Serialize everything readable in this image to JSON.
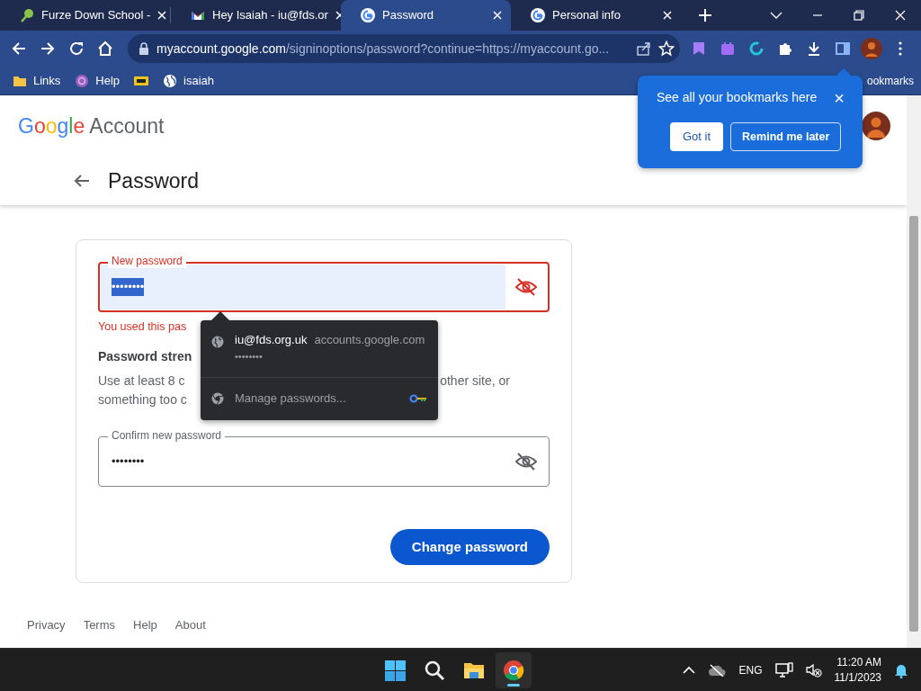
{
  "browser": {
    "tabs": [
      {
        "title": "Furze Down School - ",
        "kind": "leaf",
        "selected": false
      },
      {
        "title": "Hey Isaiah - iu@fds.or",
        "kind": "mail",
        "selected": false
      },
      {
        "title": "Password",
        "kind": "google",
        "selected": true
      },
      {
        "title": "Personal info",
        "kind": "google",
        "selected": false
      }
    ],
    "address": {
      "host": "myaccount.google.com",
      "path": "/signinoptions/password?continue=https://myaccount.go..."
    },
    "bookmarks": [
      {
        "label": "Links",
        "kind": "folder"
      },
      {
        "label": "Help",
        "kind": "badge"
      },
      {
        "kind": "tag"
      },
      {
        "label": "isaiah",
        "kind": "globe"
      }
    ],
    "all_bookmarks": "ookmarks"
  },
  "bubble": {
    "text": "See all your bookmarks here",
    "close": "×",
    "buttons": [
      "Got it",
      "Remind me later"
    ]
  },
  "header": {
    "brand": "Google",
    "product": "Account",
    "title": "Password"
  },
  "form": {
    "fields": [
      {
        "label": "New password",
        "value": "••••••••",
        "error": true,
        "autofilled": true,
        "selected": true
      },
      {
        "label": "Confirm new password",
        "value": "••••••••",
        "error": false,
        "autofilled": false,
        "selected": false
      }
    ],
    "error_message": "You used this pas",
    "strength_title": "Password stren",
    "hint_lines": [
      {
        "left": "Use at least 8 c",
        "right": "other site, or"
      },
      {
        "left": "something too c"
      }
    ],
    "submit": "Change password"
  },
  "autofill": {
    "username": "iu@fds.org.uk",
    "site": "accounts.google.com",
    "password": "••••••••",
    "manage": "Manage passwords..."
  },
  "footer": [
    "Privacy",
    "Terms",
    "Help",
    "About"
  ],
  "taskbar": {
    "apps": [
      {
        "kind": "start",
        "selected": false
      },
      {
        "kind": "search",
        "selected": false
      },
      {
        "kind": "explorer",
        "selected": false
      },
      {
        "kind": "chrome",
        "selected": true
      }
    ],
    "language": "ENG",
    "time": "11:20 AM",
    "date": "11/1/2023"
  }
}
